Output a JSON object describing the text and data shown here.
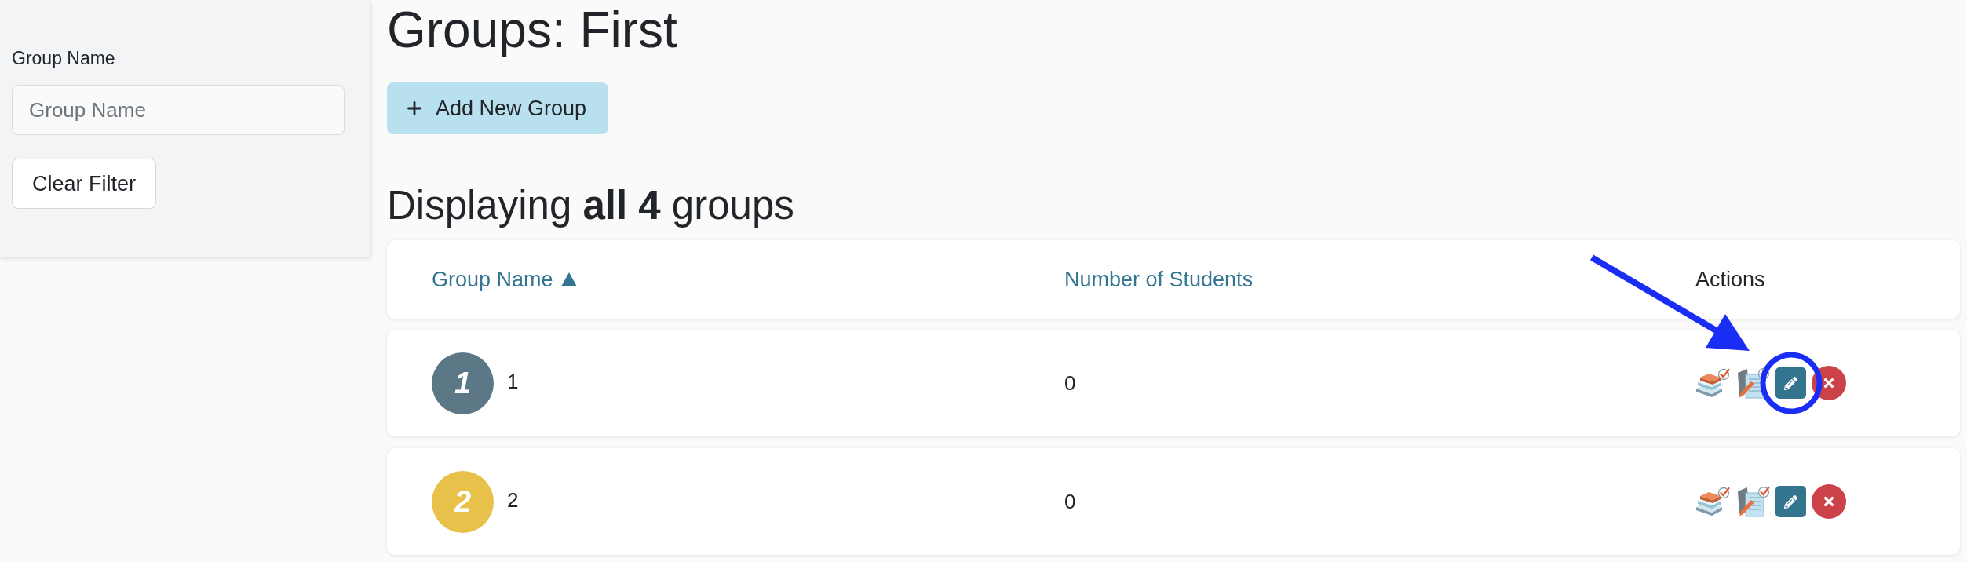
{
  "sidebar": {
    "filter_label": "Group Name",
    "filter_field": {
      "placeholder": "Group Name"
    },
    "clear_button": "Clear Filter"
  },
  "page": {
    "title": "Groups: First",
    "add_button": "Add New Group",
    "summary": "Displaying **all 4** groups"
  },
  "table": {
    "columns": [
      {
        "label": "Group Name",
        "sortable": true,
        "sorted_ascending": true
      },
      {
        "label": "Number of Students",
        "sortable": true,
        "sorted_ascending": false
      },
      {
        "label": "Actions",
        "sortable": false,
        "sorted_ascending": false
      }
    ],
    "rows": [
      {
        "badge": "1",
        "color": "#5c7886",
        "name": "1",
        "students": "0",
        "annotated": true
      },
      {
        "badge": "2",
        "color": "#e8c14a",
        "name": "2",
        "students": "0",
        "annotated": false
      }
    ]
  }
}
